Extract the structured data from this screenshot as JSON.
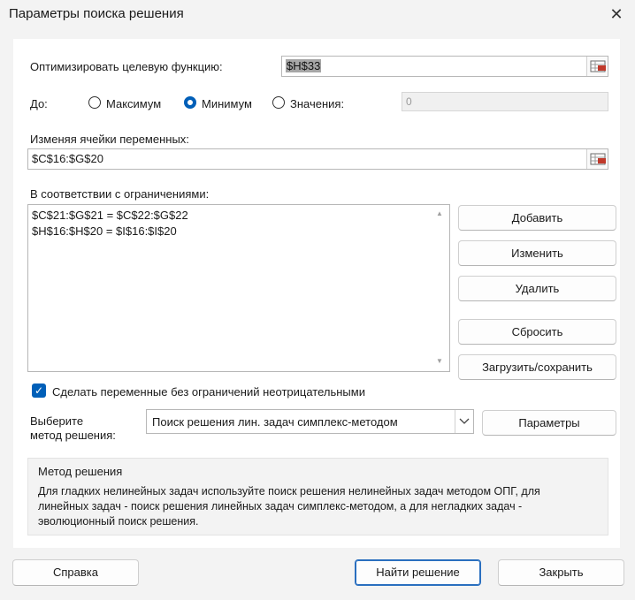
{
  "window": {
    "title": "Параметры поиска решения",
    "close_glyph": "✕"
  },
  "objective": {
    "label": "Оптимизировать целевую функцию:",
    "value": "$H$33"
  },
  "to": {
    "label": "До:",
    "options": [
      {
        "label": "Максимум",
        "checked": false
      },
      {
        "label": "Минимум",
        "checked": true
      },
      {
        "label": "Значения:",
        "checked": false
      }
    ],
    "value_field": "0"
  },
  "variables": {
    "label": "Изменяя ячейки переменных:",
    "value": "$C$16:$G$20"
  },
  "constraints": {
    "label": "В соответствии с ограничениями:",
    "items": [
      "$C$21:$G$21 = $C$22:$G$22",
      "$H$16:$H$20 = $I$16:$I$20"
    ]
  },
  "buttons": {
    "add": "Добавить",
    "change": "Изменить",
    "delete": "Удалить",
    "reset": "Сбросить",
    "load_save": "Загрузить/сохранить",
    "options": "Параметры",
    "help": "Справка",
    "solve": "Найти решение",
    "close": "Закрыть"
  },
  "nonnegative": {
    "label": "Сделать переменные без ограничений неотрицательными",
    "checked": true
  },
  "method": {
    "label_line1": "Выберите",
    "label_line2": "метод решения:",
    "selected": "Поиск решения лин. задач симплекс-методом"
  },
  "method_info": {
    "title": "Метод решения",
    "text_line1": "Для гладких нелинейных задач используйте поиск решения нелинейных задач методом ОПГ, для",
    "text_line2": "линейных задач - поиск решения линейных задач симплекс-методом, а для негладких задач -",
    "text_line3": "эволюционный поиск решения."
  },
  "colors": {
    "accent": "#005fb8",
    "selection": "#a6a6a6",
    "panel": "#ffffff",
    "window": "#f3f3f3"
  },
  "icons": {
    "ref_button": "range-select-icon",
    "combo_arrow": "chevron-down-icon",
    "scroll_up": "scroll-up-icon",
    "scroll_down": "scroll-down-icon"
  }
}
